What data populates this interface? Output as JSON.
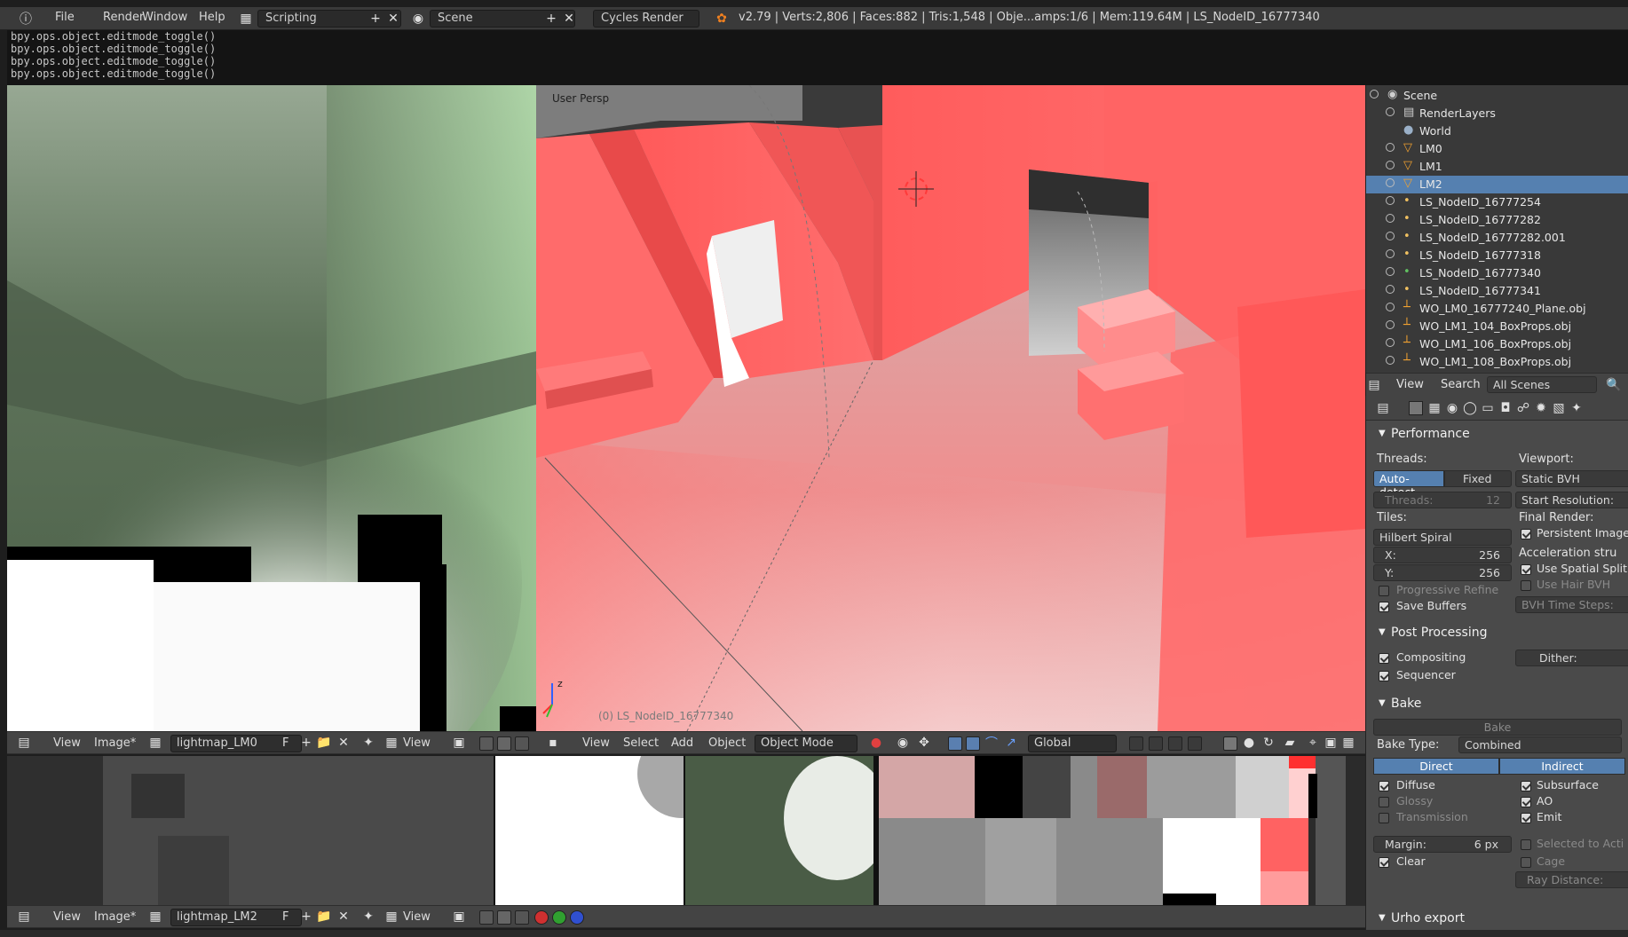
{
  "topbar": {
    "menus": [
      "File",
      "Render",
      "Window",
      "Help"
    ],
    "layout": "Scripting",
    "scene": "Scene",
    "engine": "Cycles Render",
    "stats": "v2.79 | Verts:2,806 | Faces:882 | Tris:1,548 | Obje...amps:1/6 | Mem:119.64M | LS_NodeID_16777340"
  },
  "console": {
    "lines": [
      "bpy.ops.object.editmode_toggle()",
      "bpy.ops.object.editmode_toggle()",
      "bpy.ops.object.editmode_toggle()",
      "bpy.ops.object.editmode_toggle()"
    ]
  },
  "viewport": {
    "label": "User Persp",
    "object_label": "(0) LS_NodeID_16777340",
    "axis_z": "z"
  },
  "image_editor_top": {
    "view": "View",
    "image": "Image*",
    "image_name": "lightmap_LM0",
    "fake_user": "F",
    "display": "View"
  },
  "image_editor_bottom": {
    "view": "View",
    "image": "Image*",
    "image_name": "lightmap_LM2",
    "fake_user": "F",
    "display": "View"
  },
  "view3d_header": {
    "view": "View",
    "select": "Select",
    "add": "Add",
    "object": "Object",
    "mode": "Object Mode",
    "orientation": "Global"
  },
  "outliner": {
    "items": [
      {
        "label": "Scene",
        "indent": 0,
        "icon": "scene-icon"
      },
      {
        "label": "RenderLayers",
        "indent": 1,
        "icon": "renderlayers-icon"
      },
      {
        "label": "World",
        "indent": 1,
        "icon": "world-icon"
      },
      {
        "label": "LM0",
        "indent": 1,
        "icon": "mesh-icon"
      },
      {
        "label": "LM1",
        "indent": 1,
        "icon": "mesh-icon"
      },
      {
        "label": "LM2",
        "indent": 1,
        "icon": "mesh-icon",
        "selected": true
      },
      {
        "label": "LS_NodeID_16777254",
        "indent": 1,
        "icon": "lamp-icon"
      },
      {
        "label": "LS_NodeID_16777282",
        "indent": 1,
        "icon": "lamp-icon"
      },
      {
        "label": "LS_NodeID_16777282.001",
        "indent": 1,
        "icon": "lamp-icon"
      },
      {
        "label": "LS_NodeID_16777318",
        "indent": 1,
        "icon": "lamp-icon"
      },
      {
        "label": "LS_NodeID_16777340",
        "indent": 1,
        "icon": "lamp-icon",
        "active": true
      },
      {
        "label": "LS_NodeID_16777341",
        "indent": 1,
        "icon": "lamp-icon"
      },
      {
        "label": "WO_LM0_16777240_Plane.obj",
        "indent": 1,
        "icon": "empty-icon"
      },
      {
        "label": "WO_LM1_104_BoxProps.obj",
        "indent": 1,
        "icon": "empty-icon"
      },
      {
        "label": "WO_LM1_106_BoxProps.obj",
        "indent": 1,
        "icon": "empty-icon"
      },
      {
        "label": "WO_LM1_108_BoxProps.obj",
        "indent": 1,
        "icon": "empty-icon"
      }
    ],
    "footer": {
      "view": "View",
      "search": "Search",
      "filter": "All Scenes"
    }
  },
  "properties": {
    "performance": {
      "title": "Performance",
      "threads_label": "Threads:",
      "auto_detect": "Auto-detect",
      "fixed": "Fixed",
      "threads_field": "Threads:",
      "threads_value": "12",
      "tiles_label": "Tiles:",
      "tile_order": "Hilbert Spiral",
      "x_label": "X:",
      "x_value": "256",
      "y_label": "Y:",
      "y_value": "256",
      "progressive_refine": "Progressive Refine",
      "save_buffers": "Save Buffers",
      "viewport_label": "Viewport:",
      "viewport_bvh": "Static BVH",
      "start_resolution": "Start Resolution:",
      "final_render": "Final Render:",
      "persistent_images": "Persistent Image",
      "acceleration": "Acceleration stru",
      "use_spatial_split": "Use Spatial Split",
      "use_hair_bvh": "Use Hair BVH",
      "bvh_time_steps": "BVH Time Steps:"
    },
    "post_processing": {
      "title": "Post Processing",
      "compositing": "Compositing",
      "sequencer": "Sequencer",
      "dither": "Dither:"
    },
    "bake": {
      "title": "Bake",
      "bake_button": "Bake",
      "bake_type_label": "Bake Type:",
      "bake_type": "Combined",
      "direct": "Direct",
      "indirect": "Indirect",
      "diffuse": "Diffuse",
      "glossy": "Glossy",
      "transmission": "Transmission",
      "subsurface": "Subsurface",
      "ao": "AO",
      "emit": "Emit",
      "margin_label": "Margin:",
      "margin_value": "6 px",
      "clear": "Clear",
      "selected_to_active": "Selected to Acti",
      "cage": "Cage",
      "ray_distance": "Ray Distance:"
    },
    "urho": {
      "title": "Urho export"
    }
  }
}
